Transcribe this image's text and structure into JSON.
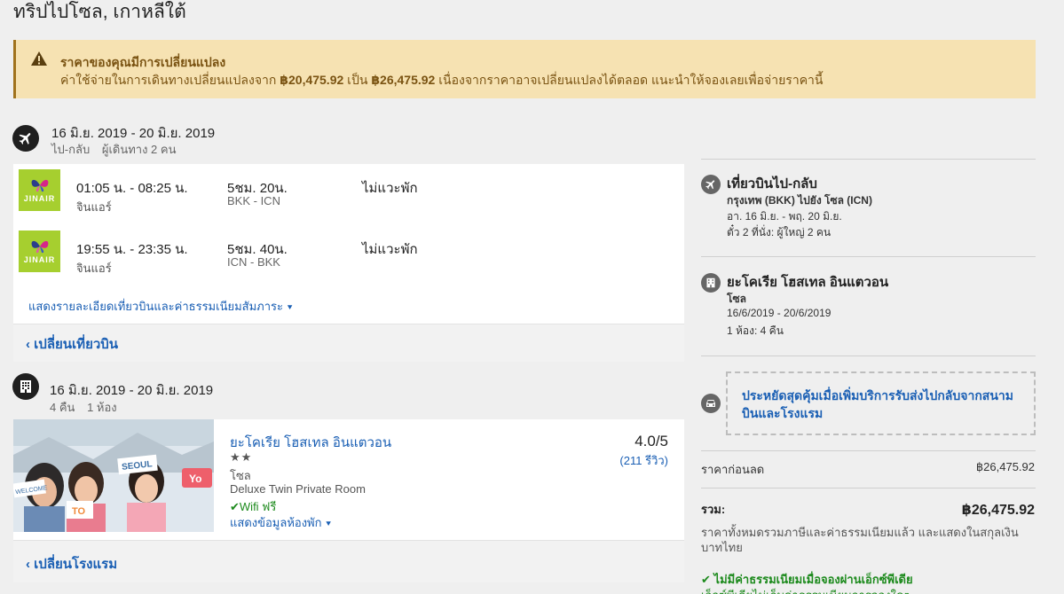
{
  "page": {
    "title": "ทริปไปโซล, เกาหลีใต้"
  },
  "alert": {
    "title": "ราคาของคุณมีการเปลี่ยนแปลง",
    "body_prefix": "ค่าใช้จ่ายในการเดินทางเปลี่ยนแปลงจาก",
    "old_price": "฿20,475.92",
    "body_mid": "เป็น",
    "new_price": "฿26,475.92",
    "body_suffix": "เนื่องจากราคาอาจเปลี่ยนแปลงได้ตลอด แนะนำให้จองเลยเพื่อจ่ายราคานี้",
    "icon": "warning-icon"
  },
  "flight_section": {
    "icon": "airplane-icon",
    "dates": "16 มิ.ย. 2019 - 20 มิ.ย. 2019",
    "trip_type": "ไป-กลับ",
    "travelers": "ผู้เดินทาง 2 คน",
    "legs": [
      {
        "times": "01:05 น. - 08:25 น.",
        "airline": "จินแอร์",
        "duration": "5ชม. 20น.",
        "route": "BKK - ICN",
        "stops": "ไม่แวะพัก",
        "logo_text": "JINAIR"
      },
      {
        "times": "19:55 น. - 23:35 น.",
        "airline": "จินแอร์",
        "duration": "5ชม. 40น.",
        "route": "ICN - BKK",
        "stops": "ไม่แวะพัก",
        "logo_text": "JINAIR"
      }
    ],
    "details_link": "แสดงรายละเอียดเที่ยวบินและค่าธรรมเนียมสัมภาระ",
    "change_link": "เปลี่ยนเที่ยวบิน"
  },
  "hotel_section": {
    "icon": "building-icon",
    "dates": "16 มิ.ย. 2019 - 20 มิ.ย. 2019",
    "nights": "4 คืน",
    "rooms": "1 ห้อง",
    "name": "ยะโคเรีย โฮสเทล อินแตวอน",
    "stars": "★★",
    "city": "โซล",
    "room_type": "Deluxe Twin Private Room",
    "wifi": "Wifi ฟรี",
    "more_link": "แสดงข้อมูลห้องพัก",
    "rating": "4.0/5",
    "reviews": "(211 รีวิว)",
    "change_link": "เปลี่ยนโรงแรม"
  },
  "summary": {
    "flight": {
      "title": "เที่ยวบินไป-กลับ",
      "route": "กรุงเทพ (BKK) ไปยัง โซล (ICN)",
      "dates": "อา. 16 มิ.ย. - พฤ. 20 มิ.ย.",
      "tickets": "ตั๋ว 2 ที่นั่ง: ผู้ใหญ่ 2 คน"
    },
    "hotel": {
      "title": "ยะโคเรีย โฮสเทล อินแตวอน",
      "city": "โซล",
      "dates": "16/6/2019 - 20/6/2019",
      "rooms": "1 ห้อง: 4 คืน"
    },
    "transfer_promo": "ประหยัดสุดคุ้มเมื่อเพิ่มบริการรับส่งไปกลับจากสนามบินและโรงแรม",
    "pre_discount_label": "ราคาก่อนลด",
    "pre_discount_value": "฿26,475.92",
    "total_label": "รวม:",
    "total_value": "฿26,475.92",
    "tax_note": "ราคาทั้งหมดรวมภาษีและค่าธรรมเนียมแล้ว และแสดงในสกุลเงิน บาทไทย",
    "fee_note": "ไม่มีค่าธรรมเนียมเมื่อจองผ่านเอ็กซ์พีเดีย",
    "fee_sub": "เอ็กซ์พีเดียไม่เก็บค่าธรรมเนียมการจองใดๆ"
  },
  "colors": {
    "link": "#1a5fb4",
    "alert_bg": "#f6e2b2",
    "alert_text": "#7a5312",
    "logo_green": "#a6cf2f",
    "success": "#1c8a1c"
  }
}
